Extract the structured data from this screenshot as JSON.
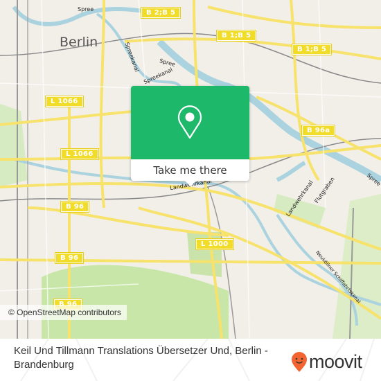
{
  "map": {
    "city_label": "Berlin",
    "road_shields": [
      {
        "id": "b2b5",
        "label": "B 2;B 5"
      },
      {
        "id": "b1b5-a",
        "label": "B 1;B 5"
      },
      {
        "id": "b1b5-b",
        "label": "B 1;B 5"
      },
      {
        "id": "l1066-a",
        "label": "L 1066"
      },
      {
        "id": "l1066-b",
        "label": "L 1066"
      },
      {
        "id": "b96a",
        "label": "B 96a"
      },
      {
        "id": "b96-a",
        "label": "B 96"
      },
      {
        "id": "b96-b",
        "label": "B 96"
      },
      {
        "id": "b96-c",
        "label": "B 96"
      },
      {
        "id": "l1000",
        "label": "L 1000"
      }
    ],
    "water_labels": {
      "spree_top": "Spree",
      "spreekanal_a": "Spreekanal",
      "spreekanal_b": "Spreekanal",
      "spree_mid": "Spree",
      "spree_right": "Spree",
      "landwehrkanal_a": "Landwehrkanal",
      "landwehrkanal_b": "Landwehrkanal",
      "flutgraben": "Flutgraben",
      "neukoellner": "Neuköllner Schiffahrtskanal"
    },
    "attribution": "© OpenStreetMap contributors"
  },
  "popup": {
    "icon": "map-pin-icon",
    "button_label": "Take me there",
    "accent_color": "#1eb86b"
  },
  "footer": {
    "address": "Keil Und Tillmann Translations Übersetzer Und, Berlin - Brandenburg",
    "brand": "moovit",
    "brand_color": "#f26430"
  }
}
